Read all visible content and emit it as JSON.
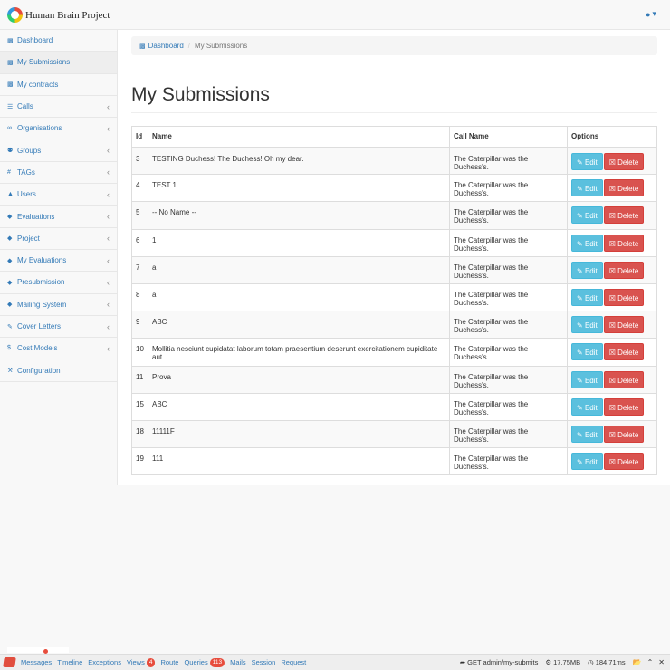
{
  "brand": {
    "name": "Human Brain Project"
  },
  "user_menu": {
    "icon": "user-icon"
  },
  "sidebar": {
    "items": [
      {
        "label": "Dashboard",
        "icon": "dashboard-icon",
        "glyph": "▩",
        "chevron": false,
        "active": false
      },
      {
        "label": "My Submissions",
        "icon": "dashboard-icon",
        "glyph": "▩",
        "chevron": false,
        "active": true
      },
      {
        "label": "My contracts",
        "icon": "dashboard-icon",
        "glyph": "▩",
        "chevron": false,
        "active": false
      },
      {
        "label": "Calls",
        "icon": "list-icon",
        "glyph": "☰",
        "chevron": true,
        "active": false
      },
      {
        "label": "Organisations",
        "icon": "link-icon",
        "glyph": "∞",
        "chevron": true,
        "active": false
      },
      {
        "label": "Groups",
        "icon": "users-icon",
        "glyph": "⚉",
        "chevron": true,
        "active": false
      },
      {
        "label": "TAGs",
        "icon": "hashtag-icon",
        "glyph": "#",
        "chevron": true,
        "active": false
      },
      {
        "label": "Users",
        "icon": "user-icon",
        "glyph": "▲",
        "chevron": true,
        "active": false
      },
      {
        "label": "Evaluations",
        "icon": "graduation-cap-icon",
        "glyph": "◆",
        "chevron": true,
        "active": false
      },
      {
        "label": "Project",
        "icon": "graduation-cap-icon",
        "glyph": "◆",
        "chevron": true,
        "active": false
      },
      {
        "label": "My Evaluations",
        "icon": "graduation-cap-icon",
        "glyph": "◆",
        "chevron": true,
        "active": false
      },
      {
        "label": "Presubmission",
        "icon": "graduation-cap-icon",
        "glyph": "◆",
        "chevron": true,
        "active": false
      },
      {
        "label": "Mailing System",
        "icon": "graduation-cap-icon",
        "glyph": "◆",
        "chevron": true,
        "active": false
      },
      {
        "label": "Cover Letters",
        "icon": "edit-icon",
        "glyph": "✎",
        "chevron": true,
        "active": false
      },
      {
        "label": "Cost Models",
        "icon": "dollar-icon",
        "glyph": "$",
        "chevron": true,
        "active": false
      },
      {
        "label": "Configuration",
        "icon": "wrench-icon",
        "glyph": "⚒",
        "chevron": false,
        "active": false
      }
    ]
  },
  "breadcrumb": {
    "home_label": "Dashboard",
    "separator": "/",
    "current_label": "My Submissions"
  },
  "page": {
    "title": "My Submissions"
  },
  "table": {
    "headers": {
      "id": "Id",
      "name": "Name",
      "call_name": "Call Name",
      "options": "Options"
    },
    "edit_label": "Edit",
    "delete_label": "Delete",
    "rows": [
      {
        "id": "3",
        "name": "TESTING Duchess! The Duchess! Oh my dear.",
        "call_name": "The Caterpillar was the Duchess's."
      },
      {
        "id": "4",
        "name": "TEST 1",
        "call_name": "The Caterpillar was the Duchess's."
      },
      {
        "id": "5",
        "name": "-- No Name --",
        "call_name": "The Caterpillar was the Duchess's."
      },
      {
        "id": "6",
        "name": "1",
        "call_name": "The Caterpillar was the Duchess's."
      },
      {
        "id": "7",
        "name": "a",
        "call_name": "The Caterpillar was the Duchess's."
      },
      {
        "id": "8",
        "name": "a",
        "call_name": "The Caterpillar was the Duchess's."
      },
      {
        "id": "9",
        "name": "ABC",
        "call_name": "The Caterpillar was the Duchess's."
      },
      {
        "id": "10",
        "name": "Mollitia nesciunt cupidatat laborum totam praesentium deserunt exercitationem cupiditate aut",
        "call_name": "The Caterpillar was the Duchess's."
      },
      {
        "id": "11",
        "name": "Prova",
        "call_name": "The Caterpillar was the Duchess's."
      },
      {
        "id": "15",
        "name": "ABC",
        "call_name": "The Caterpillar was the Duchess's."
      },
      {
        "id": "18",
        "name": "11111F",
        "call_name": "The Caterpillar was the Duchess's."
      },
      {
        "id": "19",
        "name": "111",
        "call_name": "The Caterpillar was the Duchess's."
      }
    ]
  },
  "debugbar": {
    "tabs": [
      {
        "label": "Messages",
        "badge": null
      },
      {
        "label": "Timeline",
        "badge": null
      },
      {
        "label": "Exceptions",
        "badge": null
      },
      {
        "label": "Views",
        "badge": "4"
      },
      {
        "label": "Route",
        "badge": null
      },
      {
        "label": "Queries",
        "badge": "113"
      },
      {
        "label": "Mails",
        "badge": null
      },
      {
        "label": "Session",
        "badge": null
      },
      {
        "label": "Request",
        "badge": null
      }
    ],
    "route": "GET admin/my-submits",
    "memory": "17.75MB",
    "time": "184.71ms"
  }
}
